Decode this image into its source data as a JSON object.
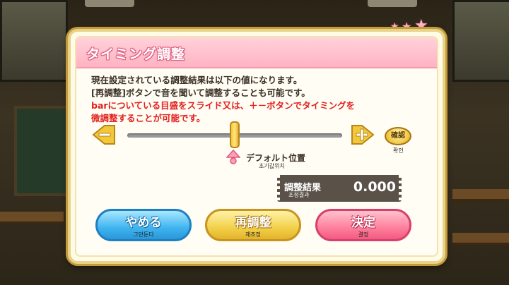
{
  "dialog": {
    "title": "タイミング調整",
    "messages": [
      {
        "text": "現在設定されている調整結果は以下の値になります。",
        "color": "dark"
      },
      {
        "text": "[再調整]ボタンで音を聞いて調整することも可能です。",
        "color": "dark"
      },
      {
        "text": "barについている目盛をスライド又は、＋－ボタンでタイミングを",
        "color": "red"
      },
      {
        "text": "微調整することが可能です。",
        "color": "red"
      }
    ]
  },
  "slider": {
    "minus_icon": "minus-arrow-icon",
    "plus_icon": "plus-arrow-icon",
    "confirm_label": "確認",
    "confirm_sub": "확인",
    "default_label": "デフォルト位置",
    "default_sub": "초기값위치",
    "position_fraction": 0.5
  },
  "result": {
    "label": "調整結果",
    "sub": "조정결과",
    "value": "0.000"
  },
  "buttons": {
    "cancel": {
      "label": "やめる",
      "sub": "그만둔다"
    },
    "readjust": {
      "label": "再調整",
      "sub": "재조정"
    },
    "decide": {
      "label": "決定",
      "sub": "결정"
    }
  },
  "colors": {
    "title_bar": "#ffb3c2",
    "accent_red": "#e2201e",
    "cancel": "#3fb4f0",
    "readjust": "#f3d04a",
    "decide": "#ff7f9c"
  }
}
